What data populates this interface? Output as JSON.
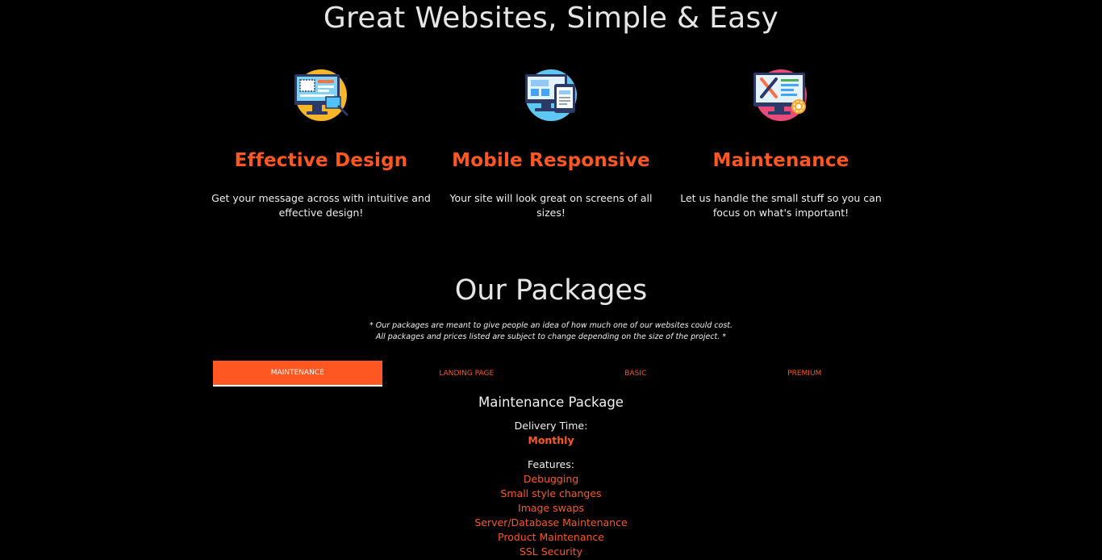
{
  "hero": {
    "title": "Great Websites, Simple & Easy"
  },
  "features": [
    {
      "icon": "monitor-design-icon",
      "title": "Effective Design",
      "text": "Get your message across with intuitive and effective design!"
    },
    {
      "icon": "responsive-devices-icon",
      "title": "Mobile Responsive",
      "text": "Your site will look great on screens of all sizes!"
    },
    {
      "icon": "maintenance-tools-icon",
      "title": "Maintenance",
      "text": "Let us handle the small stuff so you can focus on what's important!"
    }
  ],
  "packages": {
    "title": "Our Packages",
    "disclaimer_line1": "* Our packages are meant to give people an idea of how much one of our websites could cost.",
    "disclaimer_line2": "All packages and prices listed are subject to change depending on the size of the project. *",
    "tabs": [
      {
        "label": "MAINTENANCE",
        "active": true
      },
      {
        "label": "LANDING PAGE",
        "active": false
      },
      {
        "label": "BASIC",
        "active": false
      },
      {
        "label": "PREMIUM",
        "active": false
      }
    ],
    "selected": {
      "title": "Maintenance Package",
      "delivery_label": "Delivery Time:",
      "delivery_value": "Monthly",
      "features_label": "Features:",
      "features": [
        "Debugging",
        "Small style changes",
        "Image swaps",
        "Server/Database Maintenance",
        "Product Maintenance",
        "SSL Security"
      ]
    }
  },
  "colors": {
    "background": "#000000",
    "accent": "#ff5722",
    "text": "#e6e6e6"
  }
}
